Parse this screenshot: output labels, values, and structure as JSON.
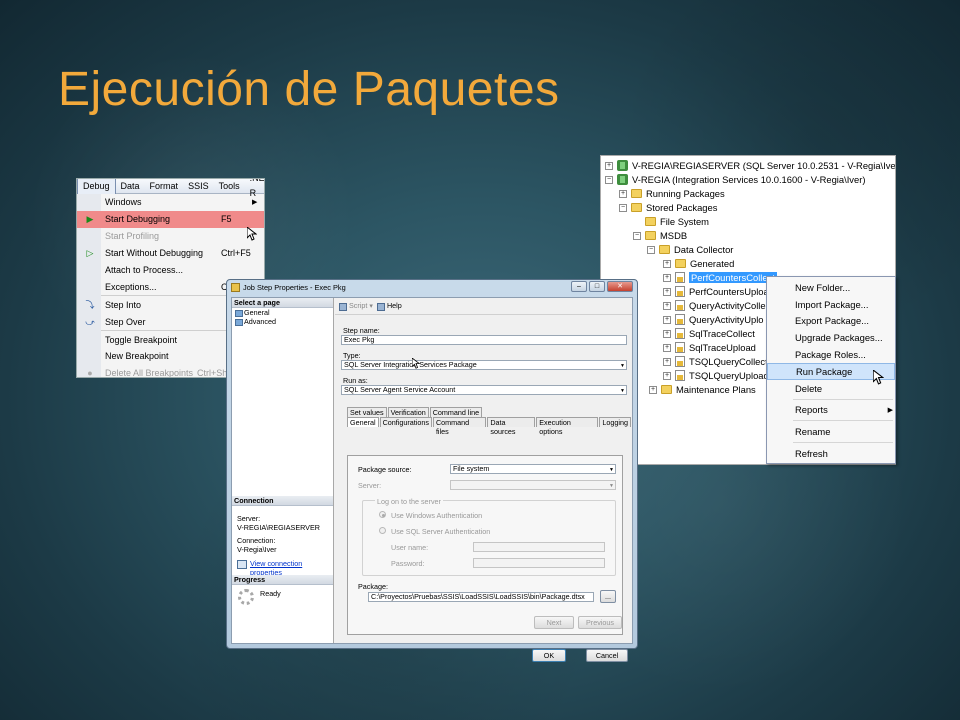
{
  "slide": {
    "title": "Ejecución de Paquetes"
  },
  "debug_menu": {
    "menubar": [
      "Debug",
      "Data",
      "Format",
      "SSIS",
      "Tools",
      ".NET R"
    ],
    "items": [
      {
        "label": "Windows",
        "shortcut": "",
        "submenu": true
      },
      {
        "label": "Start Debugging",
        "shortcut": "F5",
        "highlighted": true
      },
      {
        "label": "Start Profiling",
        "shortcut": "",
        "disabled": true
      },
      {
        "label": "Start Without Debugging",
        "shortcut": "Ctrl+F5"
      },
      {
        "label": "Attach to Process...",
        "shortcut": ""
      },
      {
        "label": "Exceptions...",
        "shortcut": "Ctr"
      },
      {
        "label": "Step Into",
        "shortcut": ""
      },
      {
        "label": "Step Over",
        "shortcut": ""
      },
      {
        "label": "Toggle Breakpoint",
        "shortcut": ""
      },
      {
        "label": "New Breakpoint",
        "shortcut": ""
      },
      {
        "label": "Delete All Breakpoints",
        "shortcut": "Ctrl+Sh",
        "disabled": true
      }
    ]
  },
  "object_explorer": {
    "nodes": [
      "V-REGIA\\REGIASERVER (SQL Server 10.0.2531 - V-Regia\\Iver)",
      "V-REGIA (Integration Services 10.0.1600 - V-Regia\\Iver)",
      "Running Packages",
      "Stored Packages",
      "File System",
      "MSDB",
      "Data Collector",
      "Generated",
      "PerfCountersCollect",
      "PerfCountersUploa",
      "QueryActivityColle",
      "QueryActivityUplo",
      "SqlTraceCollect",
      "SqlTraceUpload",
      "TSQLQueryCollect",
      "TSQLQueryUpload",
      "Maintenance Plans"
    ],
    "context_menu": [
      "New Folder...",
      "Import Package...",
      "Export Package...",
      "Upgrade Packages...",
      "Package Roles...",
      "Run Package",
      "Delete",
      "Reports",
      "Rename",
      "Refresh"
    ]
  },
  "dialog": {
    "title": "Job Step Properties - Exec Pkg",
    "select_page_header": "Select a page",
    "pages": [
      "General",
      "Advanced"
    ],
    "toolbar": {
      "script": "Script",
      "help": "Help"
    },
    "connection_header": "Connection",
    "server_label": "Server:",
    "server_value": "V-REGIA\\REGIASERVER",
    "connection_label": "Connection:",
    "connection_value": "V-Regia\\Iver",
    "view_connection": "View connection properties",
    "progress_header": "Progress",
    "progress_status": "Ready",
    "step_name_label": "Step name:",
    "step_name_value": "Exec Pkg",
    "type_label": "Type:",
    "type_value": "SQL Server Integration Services Package",
    "run_as_label": "Run as:",
    "run_as_value": "SQL Server Agent Service Account",
    "tabs_row1": [
      "Set values",
      "Verification",
      "Command line"
    ],
    "tabs_row2": [
      "General",
      "Configurations",
      "Command files",
      "Data sources",
      "Execution options",
      "Logging"
    ],
    "package_source_label": "Package source:",
    "package_source_value": "File system",
    "server_field_label": "Server:",
    "logon_group": "Log on to the server",
    "windows_auth": "Use Windows Authentication",
    "sql_auth": "Use SQL Server Authentication",
    "user_name_label": "User name:",
    "password_label": "Password:",
    "package_label": "Package:",
    "package_value": "C:\\Proyectos\\Pruebas\\SSIS\\LoadSSIS\\LoadSSIS\\bin\\Package.dtsx",
    "browse": "...",
    "next": "Next",
    "previous": "Previous",
    "ok": "OK",
    "cancel": "Cancel"
  },
  "colors": {
    "title": "#f2a93b",
    "highlight": "#f08a8a",
    "selection": "#3399ff"
  }
}
